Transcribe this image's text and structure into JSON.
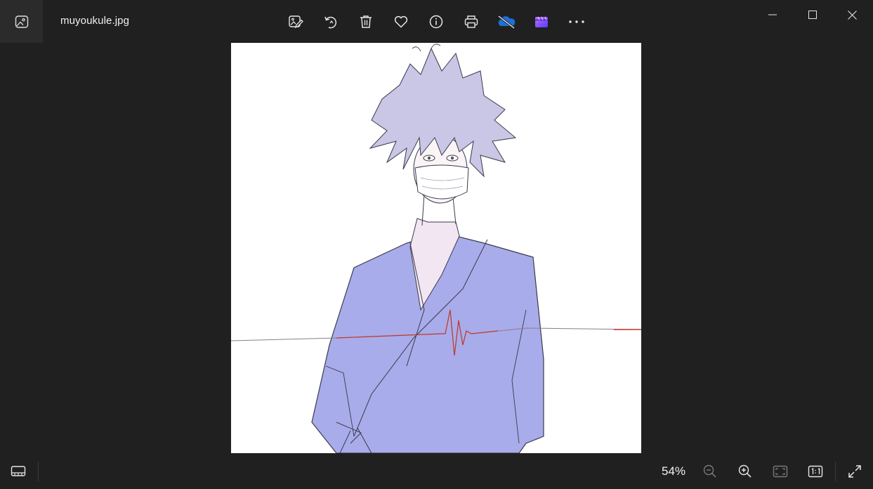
{
  "window": {
    "file_name": "muyoukule.jpg",
    "app_icon": "photos-app-icon",
    "controls": [
      "minimize-icon",
      "maximize-icon",
      "close-icon"
    ]
  },
  "toolbar": {
    "buttons": [
      {
        "name": "edit-image-button",
        "icon": "edit-image-icon"
      },
      {
        "name": "rotate-button",
        "icon": "rotate-icon"
      },
      {
        "name": "delete-button",
        "icon": "trash-icon"
      },
      {
        "name": "favorite-button",
        "icon": "heart-icon"
      },
      {
        "name": "file-info-button",
        "icon": "info-icon"
      },
      {
        "name": "print-button",
        "icon": "printer-icon"
      },
      {
        "name": "onedrive-button",
        "icon": "onedrive-cloud-off-icon"
      },
      {
        "name": "clipchamp-button",
        "icon": "clipchamp-icon"
      },
      {
        "name": "more-options-button",
        "icon": "more-dots-icon"
      }
    ],
    "accent_cloud": "#1e6fd6",
    "accent_clip": "#8a4dff"
  },
  "image": {
    "description_icon": "anime-illustration",
    "background": "#ffffff",
    "gown_color": "#a9acea",
    "hair_color": "#c9c6e6",
    "heartbeat_color": "#c0392b"
  },
  "bottom_bar": {
    "filmstrip_icon": "filmstrip-icon",
    "zoom_level": "54%",
    "zoom_out_icon": "zoom-out-icon",
    "zoom_in_icon": "zoom-in-icon",
    "fit_icon": "fit-to-window-icon",
    "actual_size_icon": "actual-size-icon",
    "fullscreen_icon": "fullscreen-icon"
  }
}
